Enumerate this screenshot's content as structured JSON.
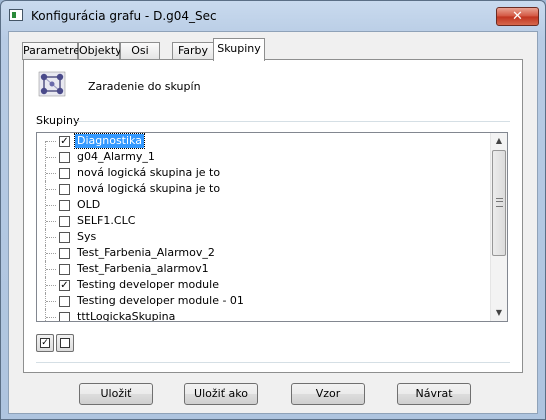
{
  "window": {
    "title": "Konfigurácia grafu -  D.g04_Sec",
    "close_symbol": "✕"
  },
  "tabs": [
    {
      "label": "Parametre",
      "active": false
    },
    {
      "label": "Objekty",
      "active": false
    },
    {
      "label": "Osi",
      "active": false
    },
    {
      "label": "Farby",
      "active": false
    },
    {
      "label": "Skupiny",
      "active": true
    }
  ],
  "panel": {
    "header_icon": "groups-icon",
    "header_text": "Zaradenie do skupín",
    "section_label": "Skupiny"
  },
  "groups": [
    {
      "label": "Diagnostika",
      "checked": true,
      "selected": true
    },
    {
      "label": "g04_Alarmy_1",
      "checked": false,
      "selected": false
    },
    {
      "label": "nová logická skupina je to",
      "checked": false,
      "selected": false
    },
    {
      "label": "nová logická skupina je to",
      "checked": false,
      "selected": false
    },
    {
      "label": "OLD",
      "checked": false,
      "selected": false
    },
    {
      "label": "SELF1.CLC",
      "checked": false,
      "selected": false
    },
    {
      "label": "Sys",
      "checked": false,
      "selected": false
    },
    {
      "label": "Test_Farbenia_Alarmov_2",
      "checked": false,
      "selected": false
    },
    {
      "label": "Test_Farbenia_alarmov1",
      "checked": false,
      "selected": false
    },
    {
      "label": "Testing developer module",
      "checked": true,
      "selected": false
    },
    {
      "label": "Testing developer module - 01",
      "checked": false,
      "selected": false
    },
    {
      "label": "tttLogickaSkupina",
      "checked": false,
      "selected": false
    }
  ],
  "check_symbol": "✓",
  "toolbar": {
    "check_all_icon": "check-all-icon",
    "uncheck_all_icon": "uncheck-all-icon"
  },
  "buttons": {
    "save": "Uložiť",
    "save_as": "Uložiť ako",
    "template": "Vzor",
    "back": "Návrat"
  }
}
